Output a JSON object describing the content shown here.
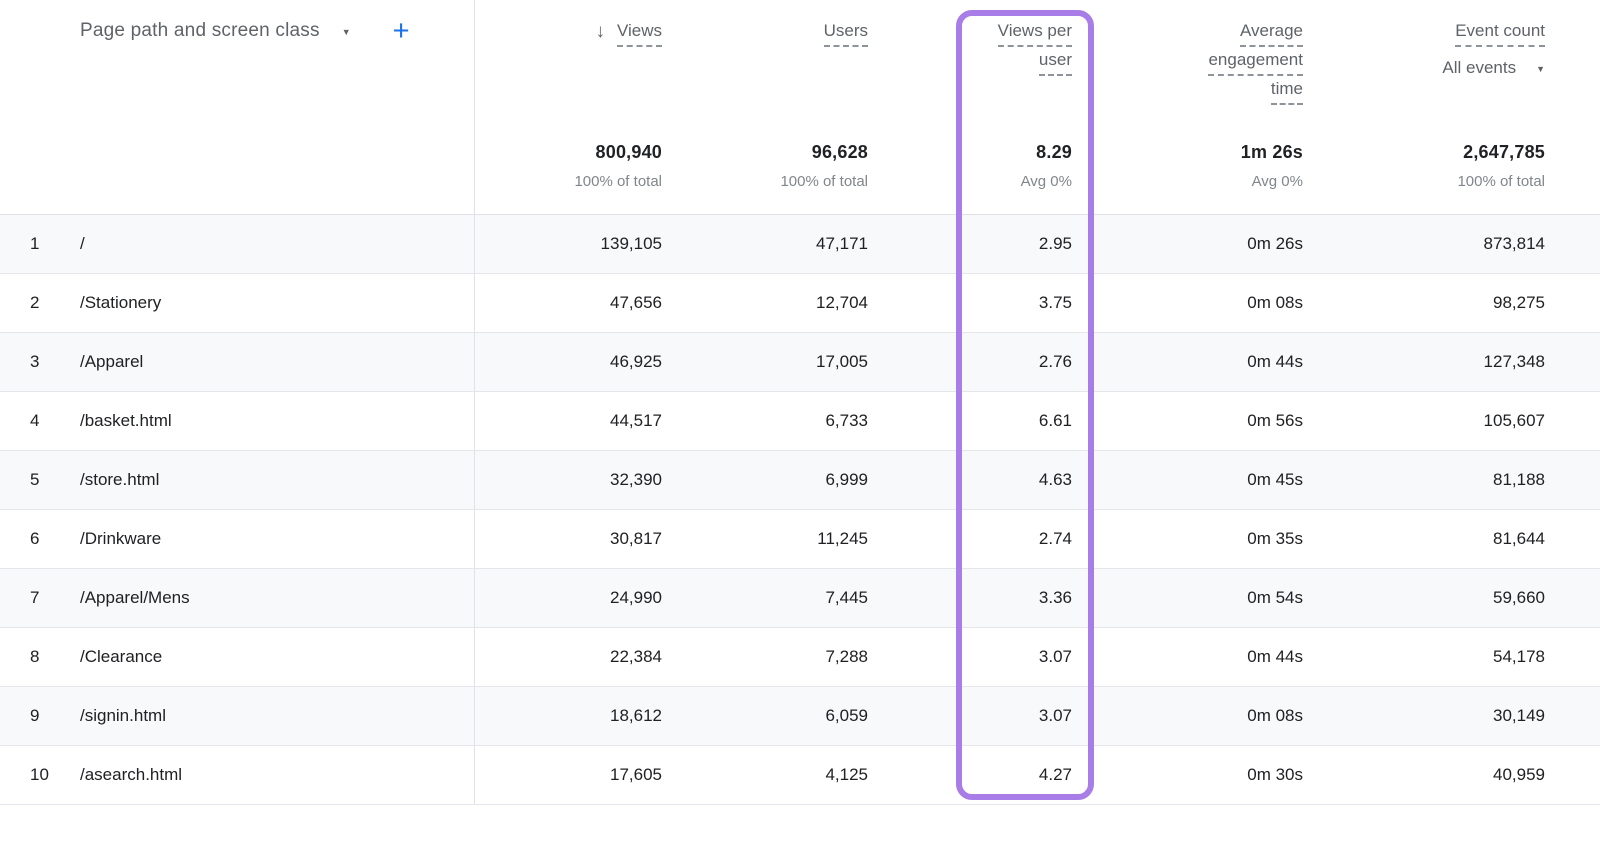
{
  "dimension": {
    "label": "Page path and screen class",
    "caret_icon": "▼",
    "add_icon": "+"
  },
  "columns": {
    "views": {
      "label": "Views",
      "sort_icon": "↓",
      "total": "800,940",
      "total_sub": "100% of total"
    },
    "users": {
      "label": "Users",
      "total": "96,628",
      "total_sub": "100% of total"
    },
    "views_per_user": {
      "label_line1": "Views per",
      "label_line2": "user",
      "total": "8.29",
      "total_sub": "Avg 0%",
      "highlighted": true
    },
    "avg_engagement_time": {
      "label_line1": "Average",
      "label_line2": "engagement",
      "label_line3": "time",
      "total": "1m 26s",
      "total_sub": "Avg 0%"
    },
    "event_count": {
      "label": "Event count",
      "filter_label": "All events",
      "filter_caret_icon": "▼",
      "total": "2,647,785",
      "total_sub": "100% of total"
    }
  },
  "rows": [
    {
      "rank": "1",
      "path": "/",
      "views": "139,105",
      "users": "47,171",
      "views_per_user": "2.95",
      "avg_engagement_time": "0m 26s",
      "event_count": "873,814"
    },
    {
      "rank": "2",
      "path": "/Stationery",
      "views": "47,656",
      "users": "12,704",
      "views_per_user": "3.75",
      "avg_engagement_time": "0m 08s",
      "event_count": "98,275"
    },
    {
      "rank": "3",
      "path": "/Apparel",
      "views": "46,925",
      "users": "17,005",
      "views_per_user": "2.76",
      "avg_engagement_time": "0m 44s",
      "event_count": "127,348"
    },
    {
      "rank": "4",
      "path": "/basket.html",
      "views": "44,517",
      "users": "6,733",
      "views_per_user": "6.61",
      "avg_engagement_time": "0m 56s",
      "event_count": "105,607"
    },
    {
      "rank": "5",
      "path": "/store.html",
      "views": "32,390",
      "users": "6,999",
      "views_per_user": "4.63",
      "avg_engagement_time": "0m 45s",
      "event_count": "81,188"
    },
    {
      "rank": "6",
      "path": "/Drinkware",
      "views": "30,817",
      "users": "11,245",
      "views_per_user": "2.74",
      "avg_engagement_time": "0m 35s",
      "event_count": "81,644"
    },
    {
      "rank": "7",
      "path": "/Apparel/Mens",
      "views": "24,990",
      "users": "7,445",
      "views_per_user": "3.36",
      "avg_engagement_time": "0m 54s",
      "event_count": "59,660"
    },
    {
      "rank": "8",
      "path": "/Clearance",
      "views": "22,384",
      "users": "7,288",
      "views_per_user": "3.07",
      "avg_engagement_time": "0m 44s",
      "event_count": "54,178"
    },
    {
      "rank": "9",
      "path": "/signin.html",
      "views": "18,612",
      "users": "6,059",
      "views_per_user": "3.07",
      "avg_engagement_time": "0m 08s",
      "event_count": "30,149"
    },
    {
      "rank": "10",
      "path": "/asearch.html",
      "views": "17,605",
      "users": "4,125",
      "views_per_user": "4.27",
      "avg_engagement_time": "0m 30s",
      "event_count": "40,959"
    }
  ],
  "colors": {
    "accent_blue": "#1a73e8",
    "highlight_purple": "#a97de8",
    "header_gray": "#5f6368",
    "subtext_gray": "#80868b",
    "row_stripe": "#f8f9fa"
  }
}
